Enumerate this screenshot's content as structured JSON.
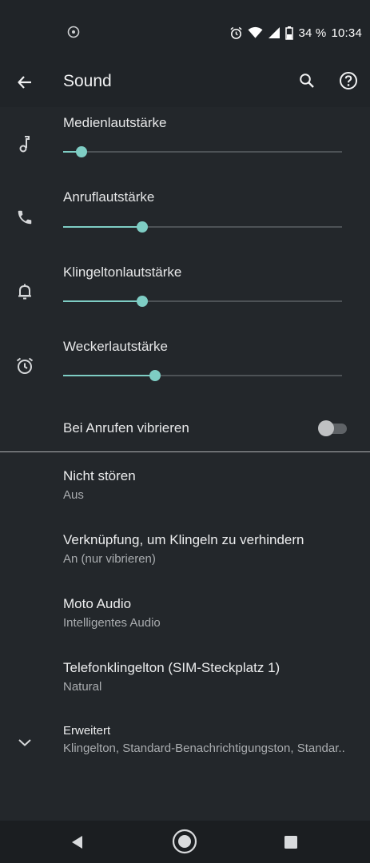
{
  "status_bar": {
    "battery_percent": "34 %",
    "time": "10:34",
    "icons": [
      "sync-circle-icon",
      "alarm-icon",
      "wifi-icon",
      "cell-signal-icon",
      "battery-icon"
    ]
  },
  "app_bar": {
    "title": "Sound",
    "icons": [
      "back-arrow-icon",
      "search-icon",
      "help-icon"
    ]
  },
  "volumes": [
    {
      "label": "Medienlautstärke",
      "icon": "music-note-icon",
      "level": 0.065
    },
    {
      "label": "Anruflautstärke",
      "icon": "phone-icon",
      "level": 0.285
    },
    {
      "label": "Klingeltonlautstärke",
      "icon": "bell-icon",
      "level": 0.285
    },
    {
      "label": "Weckerlautstärke",
      "icon": "alarm-clock-icon",
      "level": 0.33
    }
  ],
  "vibrate": {
    "label": "Bei Anrufen vibrieren",
    "enabled": false
  },
  "items": [
    {
      "title": "Nicht stören",
      "subtitle": "Aus"
    },
    {
      "title": "Verknüpfung, um Klingeln zu verhindern",
      "subtitle": "An (nur vibrieren)"
    },
    {
      "title": "Moto Audio",
      "subtitle": "Intelligentes Audio"
    },
    {
      "title": "Telefonklingelton (SIM-Steckplatz 1)",
      "subtitle": "Natural"
    }
  ],
  "advanced": {
    "title": "Erweitert",
    "subtitle": "Klingelton, Standard-Benachrichtigungston, Standar..",
    "icon": "chevron-down-icon"
  },
  "colors": {
    "accent": "#7ecdc4",
    "background": "#23272b",
    "nav_background": "#1b1e21"
  }
}
